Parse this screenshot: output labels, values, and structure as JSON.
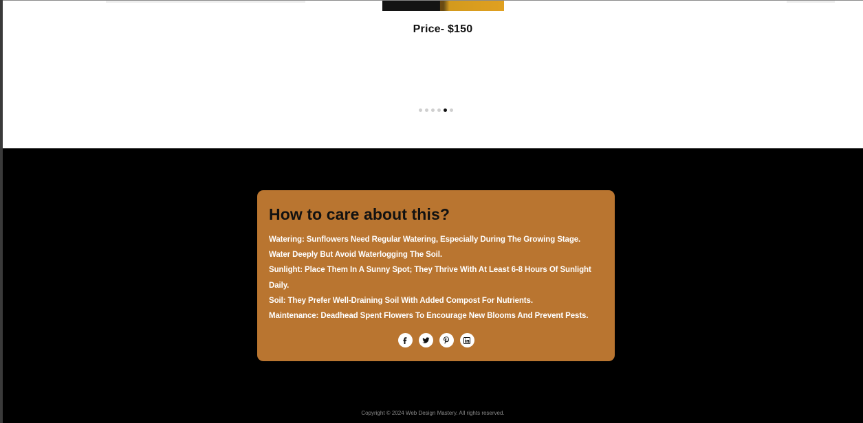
{
  "product": {
    "price": "Price- $150"
  },
  "carousel": {
    "dot_count": 6,
    "active_index": 4
  },
  "care": {
    "title": "How to care about this?",
    "lines": [
      "Watering: Sunflowers Need Regular Watering, Especially During The Growing Stage.",
      "Water Deeply But Avoid Waterlogging The Soil.",
      "Sunlight: Place Them In A Sunny Spot; They Thrive With At Least 6-8 Hours Of Sunlight",
      "Daily.",
      "Soil: They Prefer Well-Draining Soil With Added Compost For Nutrients.",
      "Maintenance: Deadhead Spent Flowers To Encourage New Blooms And Prevent Pests."
    ],
    "socials": [
      "facebook-icon",
      "twitter-icon",
      "pinterest-icon",
      "linkedin-icon"
    ]
  },
  "footer": {
    "copyright": "Copyright © 2024 Web Design Mastery. All rights reserved."
  },
  "colors": {
    "card_background": "#b97530",
    "page_background": "#000000",
    "top_background": "#ffffff"
  }
}
